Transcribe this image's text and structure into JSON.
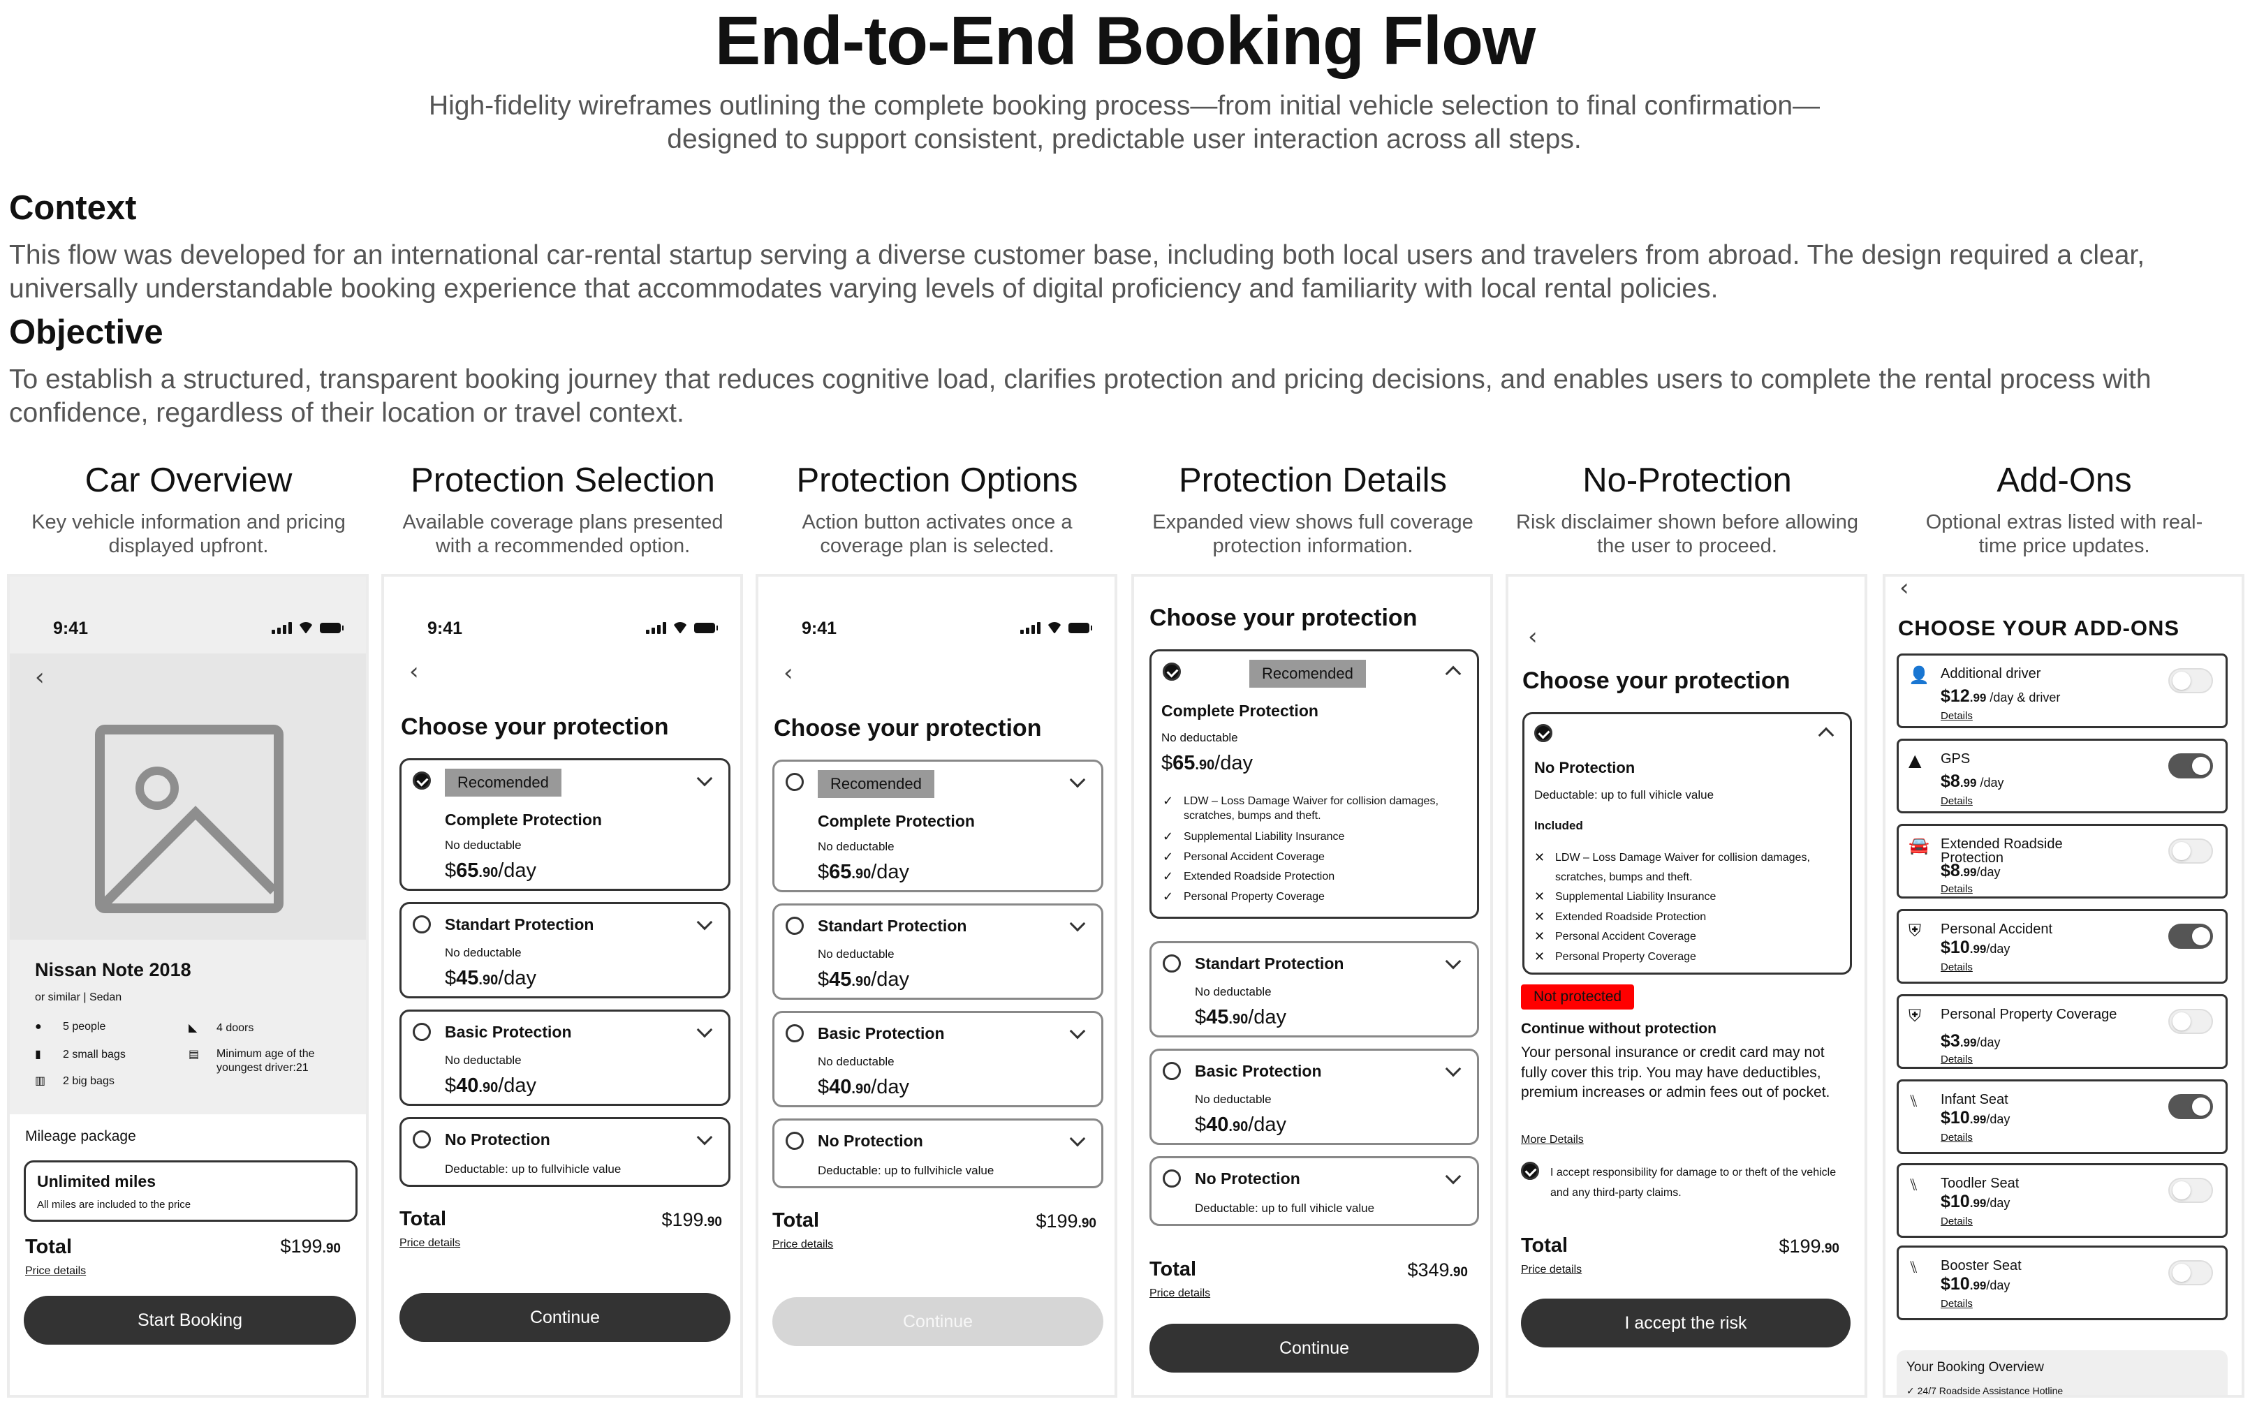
{
  "header": {
    "title": "End-to-End Booking Flow",
    "subtitle": "High-fidelity wireframes outlining the complete booking process—from initial vehicle selection to final confirmation—designed to support consistent, predictable user interaction across all steps."
  },
  "context": {
    "heading": "Context",
    "text": "This flow was developed for an international car-rental startup serving a diverse customer base, including both local users and travelers from abroad. The design required a clear, universally understandable booking experience that accommodates varying levels of digital proficiency and familiarity with local rental policies."
  },
  "objective": {
    "heading": "Objective",
    "text": "To establish a structured, transparent booking journey that reduces cognitive load, clarifies protection and pricing decisions, and enables users to complete the rental process with confidence, regardless of their location or travel context."
  },
  "columns": [
    {
      "title": "Car Overview",
      "desc": "Key vehicle information and pricing displayed upfront."
    },
    {
      "title": "Protection Selection",
      "desc": "Available coverage plans presented with a recommended option."
    },
    {
      "title": "Protection Options",
      "desc": "Action button activates once a coverage plan is selected."
    },
    {
      "title": "Protection Details",
      "desc": "Expanded view shows full coverage protection information."
    },
    {
      "title": "No-Protection",
      "desc": "Risk disclaimer shown before allowing the user to proceed."
    },
    {
      "title": "Add-Ons",
      "desc": "Optional extras listed with real-time price updates."
    }
  ],
  "status_time": "9:41",
  "choose_title": "Choose your protection",
  "recommended": "Recomended",
  "plans": {
    "complete": {
      "name": "Complete Protection",
      "note": "No deductable",
      "price": "65",
      "cents": ".90",
      "unit": "/day"
    },
    "standard": {
      "name": "Standart Protection",
      "note": "No deductable",
      "price": "45",
      "cents": ".90",
      "unit": "/day"
    },
    "basic": {
      "name": "Basic Protection",
      "note": "No deductable",
      "price": "40",
      "cents": ".90",
      "unit": "/day"
    },
    "none": {
      "name": "No Protection",
      "note": "Deductable: up to fullvihicle value",
      "note_full": "Deductable: up to full vihicle value",
      "note_noprot": "Deductable: up to full vihicle value"
    }
  },
  "total": {
    "label": "Total",
    "amount": "$199",
    "cents": ".90",
    "amount_details": "$349",
    "price_details": "Price details"
  },
  "screen1": {
    "car_name": "Nissan Note 2018",
    "car_sub": "or similar | Sedan",
    "specs": {
      "people": "5 people",
      "small_bags": "2 small bags",
      "big_bags": "2 big bags",
      "doors": "4 doors",
      "age": "Minimum age of the youngest driver:21"
    },
    "mileage_label": "Mileage package",
    "mileage_title": "Unlimited miles",
    "mileage_sub": "All miles are included to the price",
    "button": "Start Booking"
  },
  "continue_label": "Continue",
  "coverage_list": [
    "LDW – Loss Damage Waiver for collision damages, scratches, bumps and theft.",
    "Supplemental Liability Insurance",
    "Personal Accident Coverage",
    "Extended Roadside Protection",
    "Personal Property Coverage"
  ],
  "screen5": {
    "noprot_title": "No Protection",
    "noprot_note": "Deductable: up to full vihicle value",
    "included": "Included",
    "not_protected": "Not protected",
    "continue_heading": "Continue without protection",
    "continue_text": "Your personal insurance or credit card may not fully cover this trip. You may have deductibles, premium increases or admin fees out of pocket.",
    "more_details": "More Details",
    "accept_text": "I accept responsibility for damage to or theft of the vehicle and any third-party claims.",
    "button": "I accept the risk"
  },
  "screen6": {
    "title": "CHOOSE YOUR ADD-ONS",
    "details": "Details",
    "addons": [
      {
        "name": "Additional driver",
        "price": "$12",
        "cents": ".99",
        "unit": " /day & driver",
        "icon": "person-plus-icon",
        "on": false
      },
      {
        "name": "GPS",
        "price": "$8",
        "cents": ".99",
        "unit": " /day",
        "icon": "navigation-icon",
        "on": true
      },
      {
        "name": "Extended Roadside Protection",
        "price": "$8",
        "cents": ".99",
        "unit": "/day",
        "icon": "car-icon",
        "on": false
      },
      {
        "name": "Personal Accident",
        "price": "$10",
        "cents": ".99",
        "unit": "/day",
        "icon": "shield-plus-icon",
        "on": true
      },
      {
        "name": "Personal Property Coverage",
        "price": "$3",
        "cents": ".99",
        "unit": "/day",
        "icon": "shield-plus-icon",
        "on": false
      },
      {
        "name": "Infant Seat",
        "price": "$10",
        "cents": ".99",
        "unit": "/day",
        "icon": "car-seat-icon",
        "on": true
      },
      {
        "name": "Toodler  Seat",
        "price": "$10",
        "cents": ".99",
        "unit": "/day",
        "icon": "car-seat-icon",
        "on": false
      },
      {
        "name": "Booster  Seat",
        "price": "$10",
        "cents": ".99",
        "unit": "/day",
        "icon": "car-seat-icon",
        "on": false
      }
    ],
    "overview_title": "Your Booking Overview",
    "overview_item": "24/7 Roadside Assistance Hotline"
  }
}
